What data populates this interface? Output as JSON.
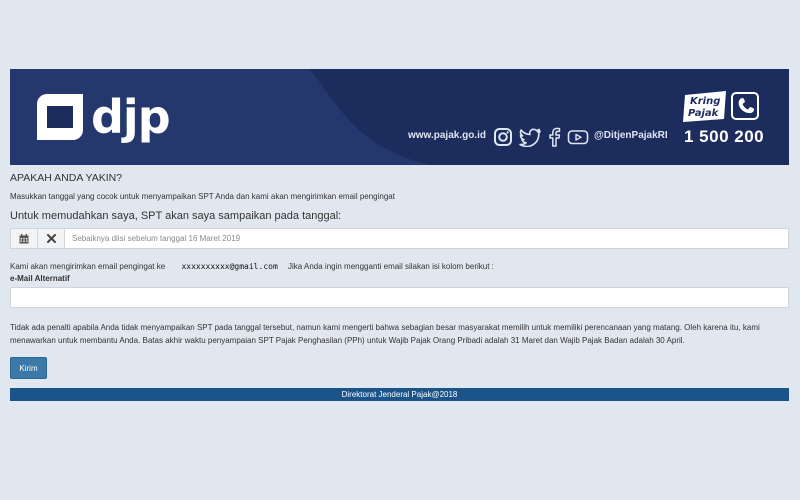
{
  "header": {
    "logo_text": "djp",
    "site_url": "www.pajak.go.id",
    "social_icons": [
      "instagram-icon",
      "twitter-icon",
      "facebook-icon",
      "youtube-icon"
    ],
    "social_handle": "@DitjenPajakRI",
    "kring_logo_line1": "Kring",
    "kring_logo_line2": "Pajak",
    "kring_number": "1 500 200"
  },
  "form": {
    "title": "APAKAH ANDA YAKIN?",
    "intro": "Masukkan tanggal yang cocok untuk menyampaikan SPT Anda dan kami akan mengirimkan email pengingat",
    "date_heading": "Untuk memudahkan saya, SPT akan saya sampaikan pada tanggal:",
    "date_placeholder": "Sebaiknya diisi sebelum tanggal 16 Maret 2019",
    "email_info_prefix": "Kami akan mengirimkan email pengingat ke",
    "email_address": "xxxxxxxxxx@gmail.com",
    "email_info_suffix": "Jika Anda ingin mengganti email silakan isi kolom berikut :",
    "alt_email_label": "e-Mail Alternatif",
    "alt_email_value": "",
    "notice": "Tidak ada penalti apabila Anda tidak menyampaikan SPT pada tanggal tersebut, namun kami mengerti bahwa sebagian besar masyarakat memilih untuk memiliki perencanaan yang matang. Oleh karena itu, kami menawarkan untuk membantu Anda. Batas akhir waktu penyampaian SPT Pajak Penghasilan (PPh) untuk Wajib Pajak Orang Pribadi adalah 31 Maret dan Wajib Pajak Badan adalah 30 April.",
    "submit_label": "Kirim"
  },
  "footer": {
    "text": "Direktorat Jenderal Pajak@2018"
  },
  "colors": {
    "banner": "#1c2c5c",
    "page_bg": "#e1e7ef",
    "button": "#3a79a8",
    "footer": "#1a5489"
  }
}
